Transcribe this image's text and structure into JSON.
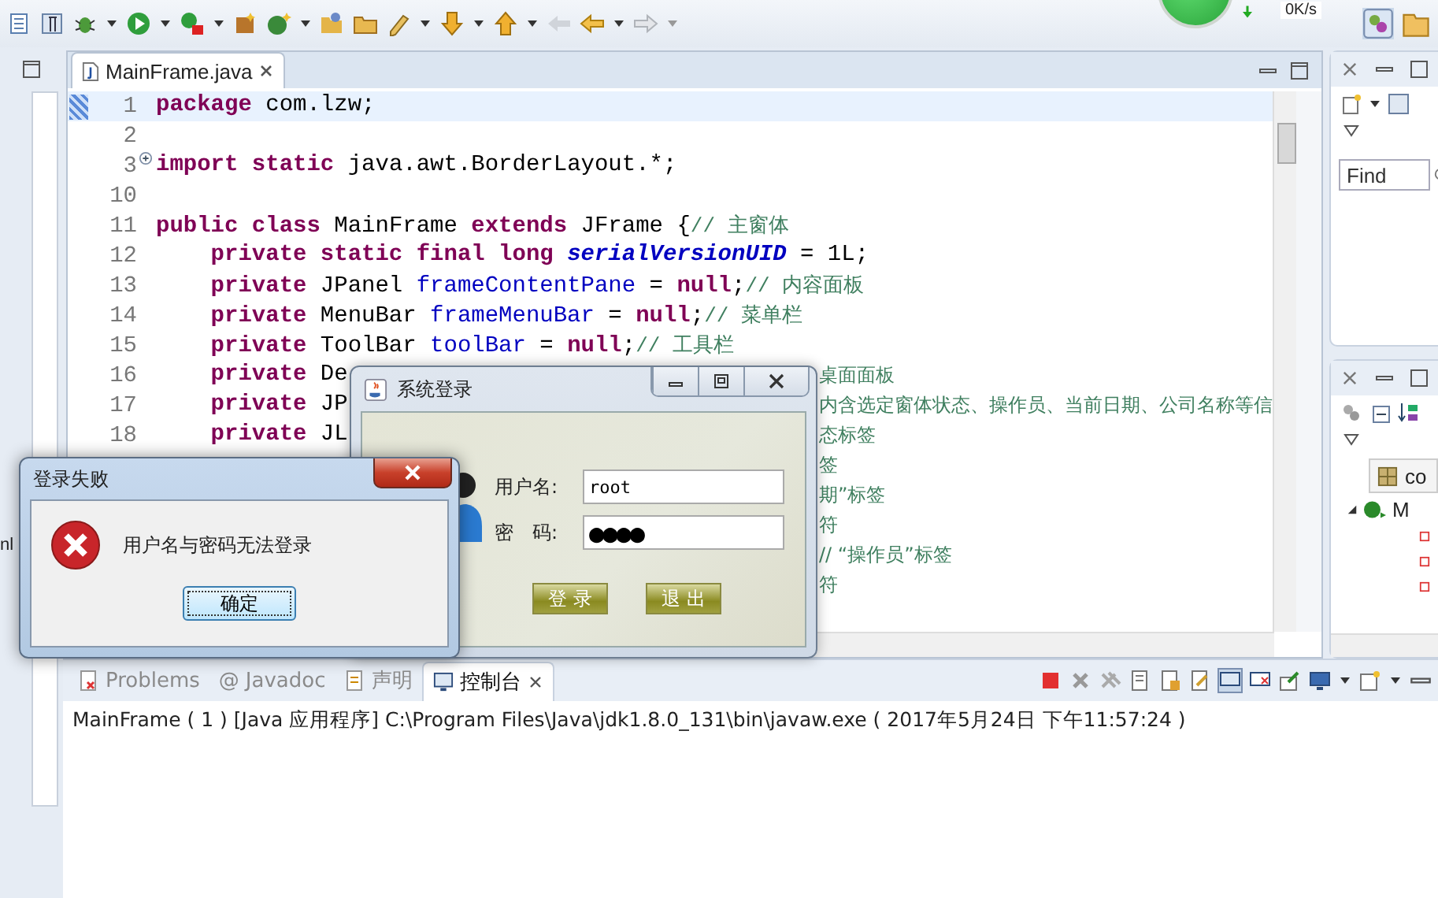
{
  "toolbar": {
    "speed": "0K/s"
  },
  "left_strip": {
    "fragment": "nl"
  },
  "editor": {
    "tabs": [
      {
        "label": "MainFrame.java",
        "selected": true
      }
    ],
    "lines": [
      {
        "number": "1",
        "current": true,
        "folded": false,
        "tokens": [
          {
            "kind": "keyword",
            "text": "package"
          },
          {
            "kind": "plain",
            "text": " com.lzw;"
          }
        ]
      },
      {
        "number": "2",
        "current": false,
        "folded": false
      },
      {
        "number": "3",
        "current": false,
        "folded": true,
        "tokens": [
          {
            "kind": "keyword",
            "text": "import"
          },
          {
            "kind": "keyword",
            "text": " static"
          },
          {
            "kind": "plain",
            "text": " java.awt.BorderLayout.*;"
          }
        ]
      },
      {
        "number": "10",
        "current": false,
        "folded": false
      },
      {
        "number": "11",
        "current": false,
        "folded": false,
        "tokens": [
          {
            "kind": "keyword",
            "text": "public"
          },
          {
            "kind": "keyword",
            "text": " class"
          },
          {
            "kind": "plain",
            "text": " MainFrame "
          },
          {
            "kind": "keyword",
            "text": "extends"
          },
          {
            "kind": "plain",
            "text": " JFrame {"
          },
          {
            "kind": "comment",
            "text": "// 主窗体"
          }
        ]
      },
      {
        "number": "12",
        "current": false,
        "folded": false,
        "tokens": [
          {
            "kind": "keyword",
            "text": "    private"
          },
          {
            "kind": "keyword",
            "text": " static"
          },
          {
            "kind": "keyword",
            "text": " final"
          },
          {
            "kind": "keyword",
            "text": " long"
          },
          {
            "kind": "constant",
            "text": " serialVersionUID"
          },
          {
            "kind": "plain",
            "text": " = 1L;"
          }
        ]
      },
      {
        "number": "13",
        "current": false,
        "folded": false,
        "tokens": [
          {
            "kind": "keyword",
            "text": "    private"
          },
          {
            "kind": "plain",
            "text": " JPanel "
          },
          {
            "kind": "field",
            "text": "frameContentPane"
          },
          {
            "kind": "plain",
            "text": " = "
          },
          {
            "kind": "keyword",
            "text": "null"
          },
          {
            "kind": "plain",
            "text": ";"
          },
          {
            "kind": "comment",
            "text": "// 内容面板"
          }
        ]
      },
      {
        "number": "14",
        "current": false,
        "folded": false,
        "tokens": [
          {
            "kind": "keyword",
            "text": "    private"
          },
          {
            "kind": "plain",
            "text": " MenuBar "
          },
          {
            "kind": "field",
            "text": "frameMenuBar"
          },
          {
            "kind": "plain",
            "text": " = "
          },
          {
            "kind": "keyword",
            "text": "null"
          },
          {
            "kind": "plain",
            "text": ";"
          },
          {
            "kind": "comment",
            "text": "// 菜单栏"
          }
        ]
      },
      {
        "number": "15",
        "current": false,
        "folded": false,
        "tokens": [
          {
            "kind": "keyword",
            "text": "    private"
          },
          {
            "kind": "plain",
            "text": " ToolBar "
          },
          {
            "kind": "field",
            "text": "toolBar"
          },
          {
            "kind": "plain",
            "text": " = "
          },
          {
            "kind": "keyword",
            "text": "null"
          },
          {
            "kind": "plain",
            "text": ";"
          },
          {
            "kind": "comment",
            "text": "// 工具栏"
          }
        ]
      },
      {
        "number": "16",
        "current": false,
        "folded": false,
        "tokens": [
          {
            "kind": "keyword",
            "text": "    private"
          },
          {
            "kind": "plain",
            "text": " De"
          }
        ],
        "tail": "桌面面板"
      },
      {
        "number": "17",
        "current": false,
        "folded": false,
        "tokens": [
          {
            "kind": "keyword",
            "text": "    private"
          },
          {
            "kind": "plain",
            "text": " JP"
          }
        ],
        "tail": "内含选定窗体状态、操作员、当前日期、公司名称等信"
      },
      {
        "number": "18",
        "current": false,
        "folded": false,
        "tokens": [
          {
            "kind": "keyword",
            "text": "    private"
          },
          {
            "kind": "plain",
            "text": " JL"
          }
        ],
        "tail": "态标签"
      },
      {
        "current": false,
        "folded": false,
        "tail": "签"
      },
      {
        "current": false,
        "folded": false,
        "tail": "期”标签"
      },
      {
        "current": false,
        "folded": false,
        "tail": "符"
      },
      {
        "current": false,
        "folded": false,
        "tail": "// “操作员”标签"
      },
      {
        "current": false,
        "folded": false,
        "tail": "符"
      }
    ]
  },
  "find_panel": {
    "search": {
      "placeholder": "Find"
    }
  },
  "outline_panel": {
    "items": [
      {
        "kind": "imports",
        "label": "co"
      },
      {
        "kind": "class",
        "label": "M",
        "expanded": true
      }
    ]
  },
  "console": {
    "tabs": [
      {
        "kind": "problems",
        "label": "Problems",
        "selected": false
      },
      {
        "kind": "javadoc",
        "glyph": "@",
        "label": "Javadoc",
        "selected": false
      },
      {
        "kind": "declaration",
        "label": "声明",
        "selected": false
      },
      {
        "kind": "console",
        "label": "控制台",
        "selected": true
      }
    ],
    "output": "MainFrame ( 1 )  [Java 应用程序] C:\\Program Files\\Java\\jdk1.8.0_131\\bin\\javaw.exe ( 2017年5月24日 下午11:57:24 )"
  },
  "login_window": {
    "title": "系统登录",
    "username_label": "用户名:",
    "username": "root",
    "password_label": "密　码:",
    "password": "●●●●",
    "buttons": [
      "登 录",
      "退 出"
    ]
  },
  "error_dialog": {
    "title": "登录失败",
    "message": "用户名与密码无法登录",
    "button": "确定"
  }
}
